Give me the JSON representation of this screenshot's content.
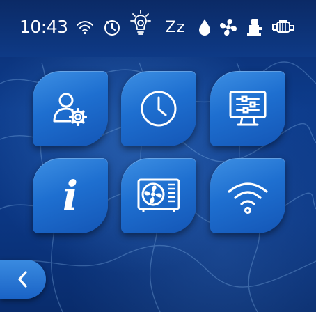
{
  "status_bar": {
    "time": "10:43",
    "icons": [
      "wifi-icon",
      "timer-icon",
      "light-icon",
      "sleep-icon",
      "water-drop-icon",
      "fan-icon",
      "heater-icon",
      "pump-icon"
    ],
    "sleep_glyph": "Zz"
  },
  "tiles": [
    {
      "name": "user-settings",
      "icon": "user-gear-icon"
    },
    {
      "name": "clock",
      "icon": "clock-icon"
    },
    {
      "name": "display-settings",
      "icon": "monitor-sliders-icon"
    },
    {
      "name": "info",
      "icon": "info-icon",
      "glyph": "i"
    },
    {
      "name": "heat-pump",
      "icon": "heat-pump-icon"
    },
    {
      "name": "wifi",
      "icon": "wifi-icon"
    }
  ],
  "nav": {
    "back_icon": "chevron-left-icon"
  },
  "colors": {
    "tile": "#2a7ddb",
    "background": "#0d3c8c",
    "icon": "#ffffff"
  }
}
